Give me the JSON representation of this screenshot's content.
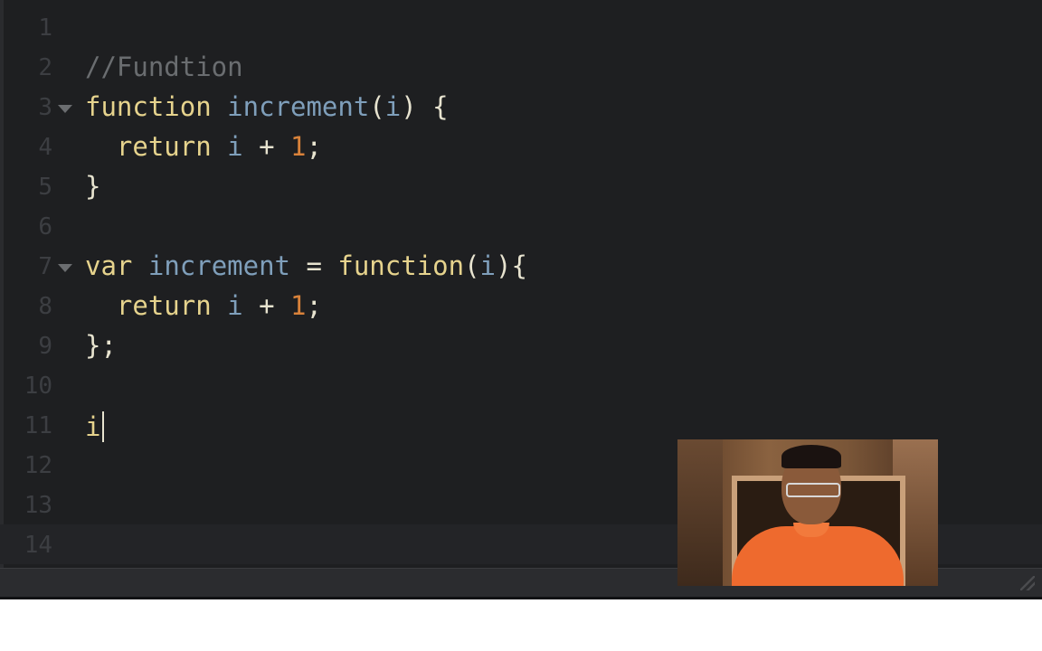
{
  "editor": {
    "lines": [
      {
        "num": "1",
        "tokens": []
      },
      {
        "num": "2",
        "tokens": [
          {
            "t": "//Fundtion",
            "c": "cm"
          }
        ]
      },
      {
        "num": "3",
        "fold": true,
        "tokens": [
          {
            "t": "function",
            "c": "kw"
          },
          {
            "t": " ",
            "c": "op"
          },
          {
            "t": "increment",
            "c": "fn"
          },
          {
            "t": "(",
            "c": "op"
          },
          {
            "t": "i",
            "c": "par"
          },
          {
            "t": ") {",
            "c": "op"
          }
        ]
      },
      {
        "num": "4",
        "tokens": [
          {
            "t": "  ",
            "c": "op"
          },
          {
            "t": "return",
            "c": "kw"
          },
          {
            "t": " ",
            "c": "op"
          },
          {
            "t": "i",
            "c": "par"
          },
          {
            "t": " + ",
            "c": "op"
          },
          {
            "t": "1",
            "c": "num"
          },
          {
            "t": ";",
            "c": "op"
          }
        ]
      },
      {
        "num": "5",
        "tokens": [
          {
            "t": "}",
            "c": "op"
          }
        ]
      },
      {
        "num": "6",
        "tokens": []
      },
      {
        "num": "7",
        "fold": true,
        "tokens": [
          {
            "t": "var",
            "c": "kw"
          },
          {
            "t": " ",
            "c": "op"
          },
          {
            "t": "increment",
            "c": "fn"
          },
          {
            "t": " = ",
            "c": "op"
          },
          {
            "t": "function",
            "c": "kw"
          },
          {
            "t": "(",
            "c": "op"
          },
          {
            "t": "i",
            "c": "par"
          },
          {
            "t": "){",
            "c": "op"
          }
        ]
      },
      {
        "num": "8",
        "tokens": [
          {
            "t": "  ",
            "c": "op"
          },
          {
            "t": "return",
            "c": "kw"
          },
          {
            "t": " ",
            "c": "op"
          },
          {
            "t": "i",
            "c": "par"
          },
          {
            "t": " + ",
            "c": "op"
          },
          {
            "t": "1",
            "c": "num"
          },
          {
            "t": ";",
            "c": "op"
          }
        ]
      },
      {
        "num": "9",
        "tokens": [
          {
            "t": "};",
            "c": "op"
          }
        ]
      },
      {
        "num": "10",
        "tokens": []
      },
      {
        "num": "11",
        "cursor": true,
        "tokens": [
          {
            "t": "i",
            "c": "kw"
          }
        ]
      },
      {
        "num": "12",
        "tokens": []
      },
      {
        "num": "13",
        "tokens": []
      },
      {
        "num": "14",
        "active": true,
        "tokens": []
      }
    ]
  },
  "colors": {
    "background": "#1e1f21",
    "comment": "#6a6d70",
    "keyword": "#e6d38d",
    "identifier": "#7f9fbb",
    "number": "#d9823a",
    "text": "#e7e3cf",
    "gutter": "#3c3e42"
  },
  "webcam": {
    "icon": "presenter-webcam-video"
  }
}
